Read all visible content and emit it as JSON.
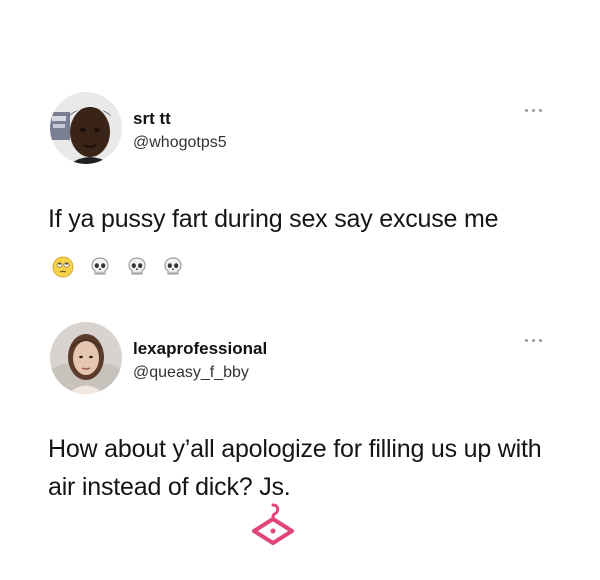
{
  "tweets": [
    {
      "display_name": "srt tt",
      "handle": "@whogotps5",
      "text": "If ya pussy fart during sex say excuse me",
      "emojis": [
        "rolling-eyes-emoji",
        "skull-emoji",
        "skull-emoji",
        "skull-emoji"
      ]
    },
    {
      "display_name": "lexaprofessional",
      "handle": "@queasy_f_bby",
      "text": "How about y’all apologize for filling us up with air instead of dick? Js."
    }
  ],
  "icons": {
    "more": "more-options-icon",
    "watermark": "hanger-watermark-icon"
  },
  "colors": {
    "watermark": "#e0457b",
    "name": "#111111",
    "handle": "#333333",
    "dots": "#9a9a9a"
  }
}
